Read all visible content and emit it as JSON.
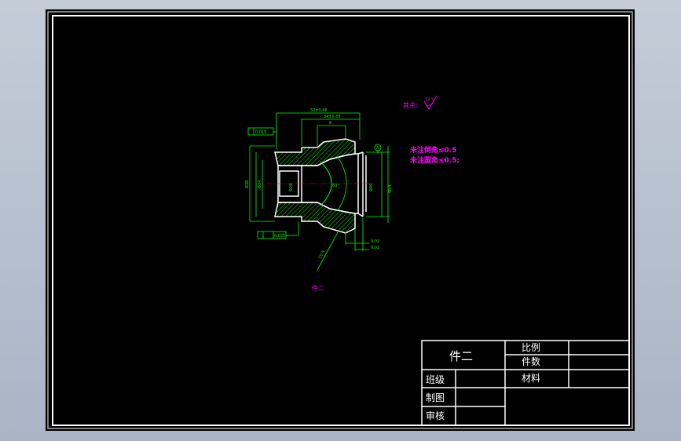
{
  "drawing": {
    "part_label": "件二",
    "surface_finish": {
      "prefix": "其余:",
      "value": "12.5"
    },
    "notes": [
      "未注倒角≤0.5",
      "未注圆角≤0.5;"
    ],
    "dimensions": {
      "top_overall": "52±0.06",
      "top_mid": "34±0.05",
      "top_short": "8",
      "gdt_top": "0.015",
      "gdt_bottom": "0.025",
      "diam_left_outer": "Φ38",
      "diam_left_inner": "Φ34",
      "diam_bore": "Φ28",
      "diam_right_outer": "Φ54",
      "diam_right_inner": "Φ46",
      "angle": "60°",
      "right_b1": "0.02",
      "right_b2": "0.02",
      "chamfer": "C0.5",
      "datum": "A"
    }
  },
  "title_block": {
    "part_name": "件二",
    "scale_label": "比例",
    "quantity_label": "件数",
    "material_label": "材料",
    "class_label": "班级",
    "drafter_label": "制图",
    "reviewer_label": "审核",
    "scale_value": "",
    "quantity_value": "",
    "material_value": ""
  },
  "colors": {
    "sheet": "#000000",
    "border": "#ffffff",
    "geometry": "#ffffff",
    "dimension": "#00ff00",
    "annotation": "#ff00ff",
    "hatch": "#00ff00"
  }
}
